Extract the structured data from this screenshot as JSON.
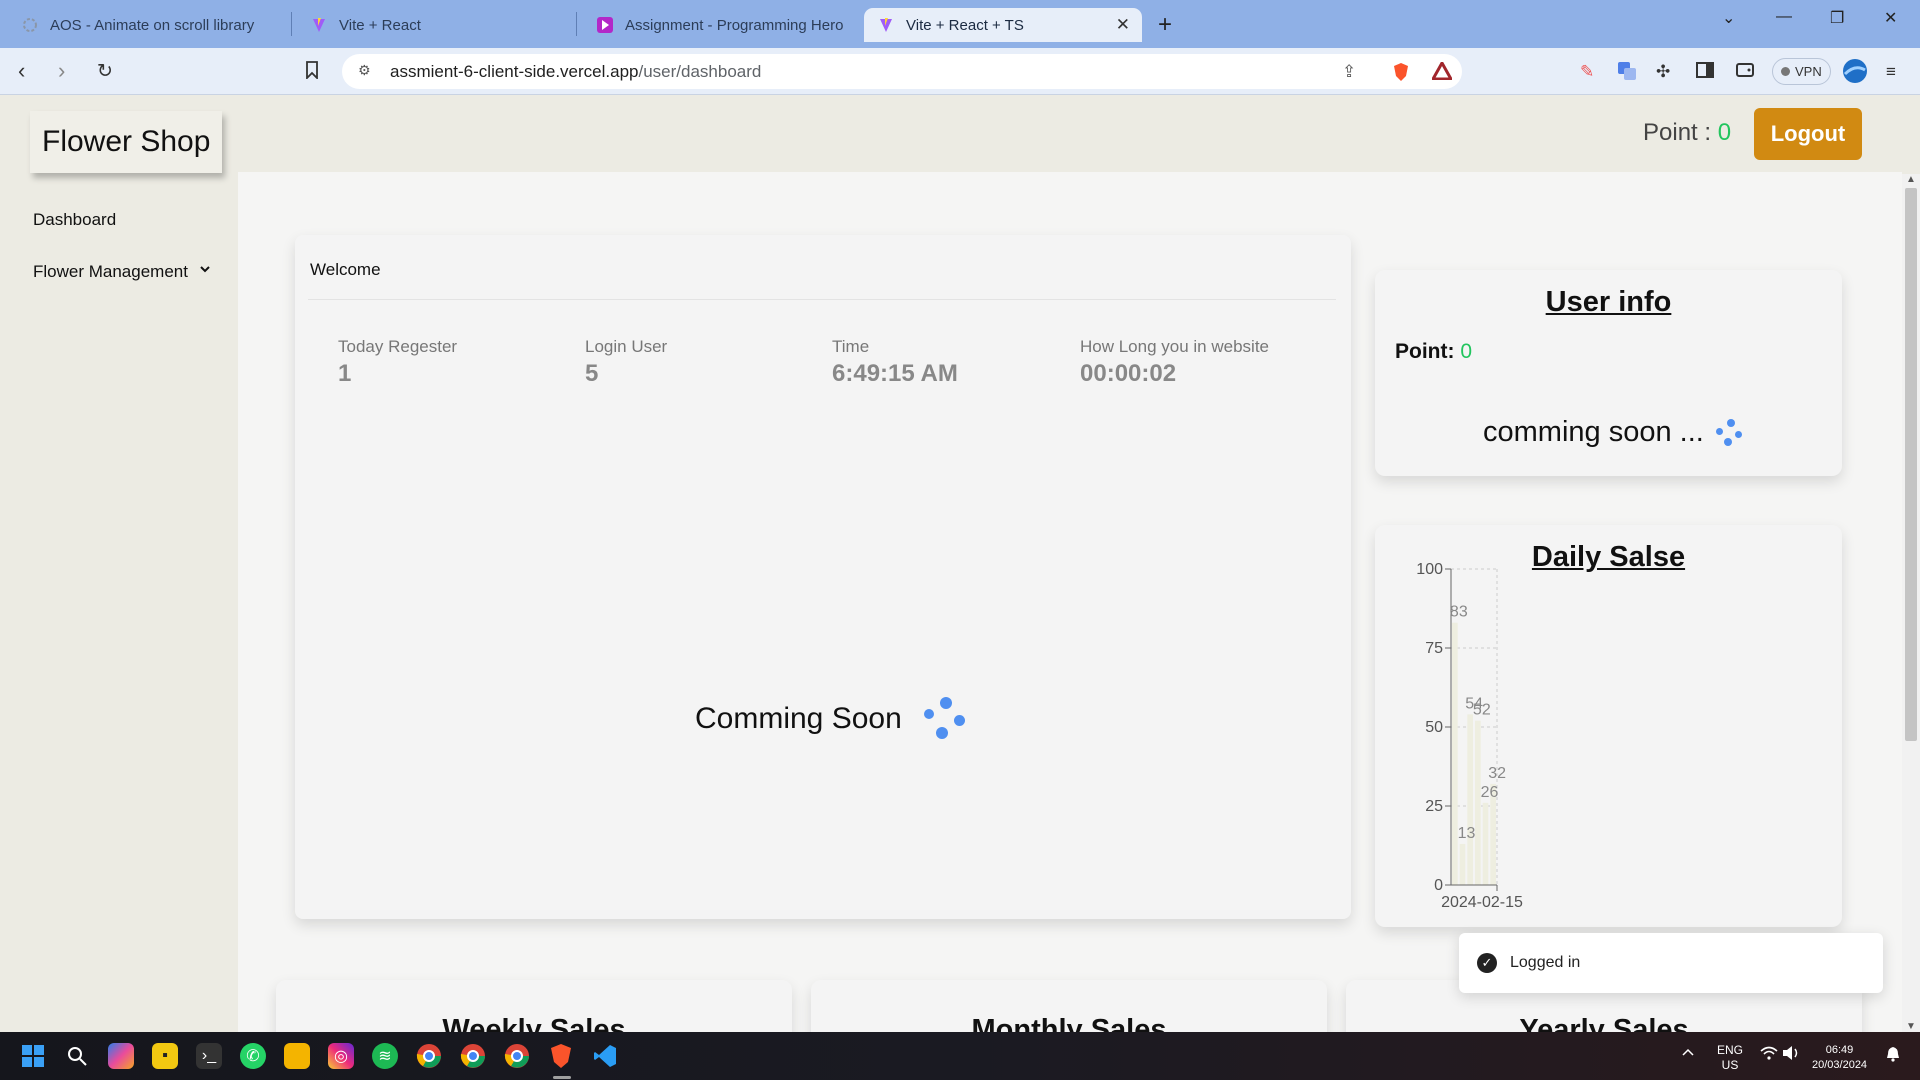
{
  "browser": {
    "tabs": [
      {
        "title": "AOS - Animate on scroll library",
        "active": false
      },
      {
        "title": "Vite + React",
        "active": false
      },
      {
        "title": "Assignment - Programming Hero",
        "active": false
      },
      {
        "title": "Vite + React + TS",
        "active": true
      }
    ],
    "url_host": "assmient-6-client-side.vercel.app",
    "url_path": "/user/dashboard",
    "vpn_label": "VPN"
  },
  "app": {
    "logo": "Flower Shop",
    "sidebar": [
      {
        "label": "Dashboard"
      },
      {
        "label": "Flower Management"
      }
    ],
    "point_label": "Point : ",
    "point_value": "0",
    "logout_label": "Logout"
  },
  "welcome": {
    "title": "Welcome",
    "stats": [
      {
        "label": "Today Regester",
        "value": "1"
      },
      {
        "label": "Login User",
        "value": "5"
      },
      {
        "label": "Time",
        "value": "6:49:15 AM"
      },
      {
        "label": "How Long you in website",
        "value": "00:00:02"
      }
    ],
    "coming_soon": "Comming Soon"
  },
  "user_info": {
    "title": "User info",
    "point_label": "Point: ",
    "point_value": "0",
    "coming_soon": "comming soon ..."
  },
  "daily_sales": {
    "title": "Daily Salse"
  },
  "bottom_cards": [
    {
      "title": "Weekly Sales"
    },
    {
      "title": "Monthly Sales"
    },
    {
      "title": "Yearly Sales"
    }
  ],
  "toast": {
    "message": "Logged in"
  },
  "taskbar": {
    "lang_top": "ENG",
    "lang_bottom": "US",
    "time": "06:49",
    "date": "20/03/2024"
  },
  "chart_data": {
    "type": "bar",
    "title": "Daily Salse",
    "categories": [
      "2024-02-15"
    ],
    "x_tick_labels": [
      "2024-02-15"
    ],
    "values": [
      83,
      13,
      54,
      52,
      26,
      32
    ],
    "ylim": [
      0,
      100
    ],
    "y_ticks": [
      0,
      25,
      50,
      75,
      100
    ],
    "grid": true,
    "colors": {
      "bar": "#eeeee0",
      "axis": "#666666",
      "label": "#888888"
    }
  }
}
